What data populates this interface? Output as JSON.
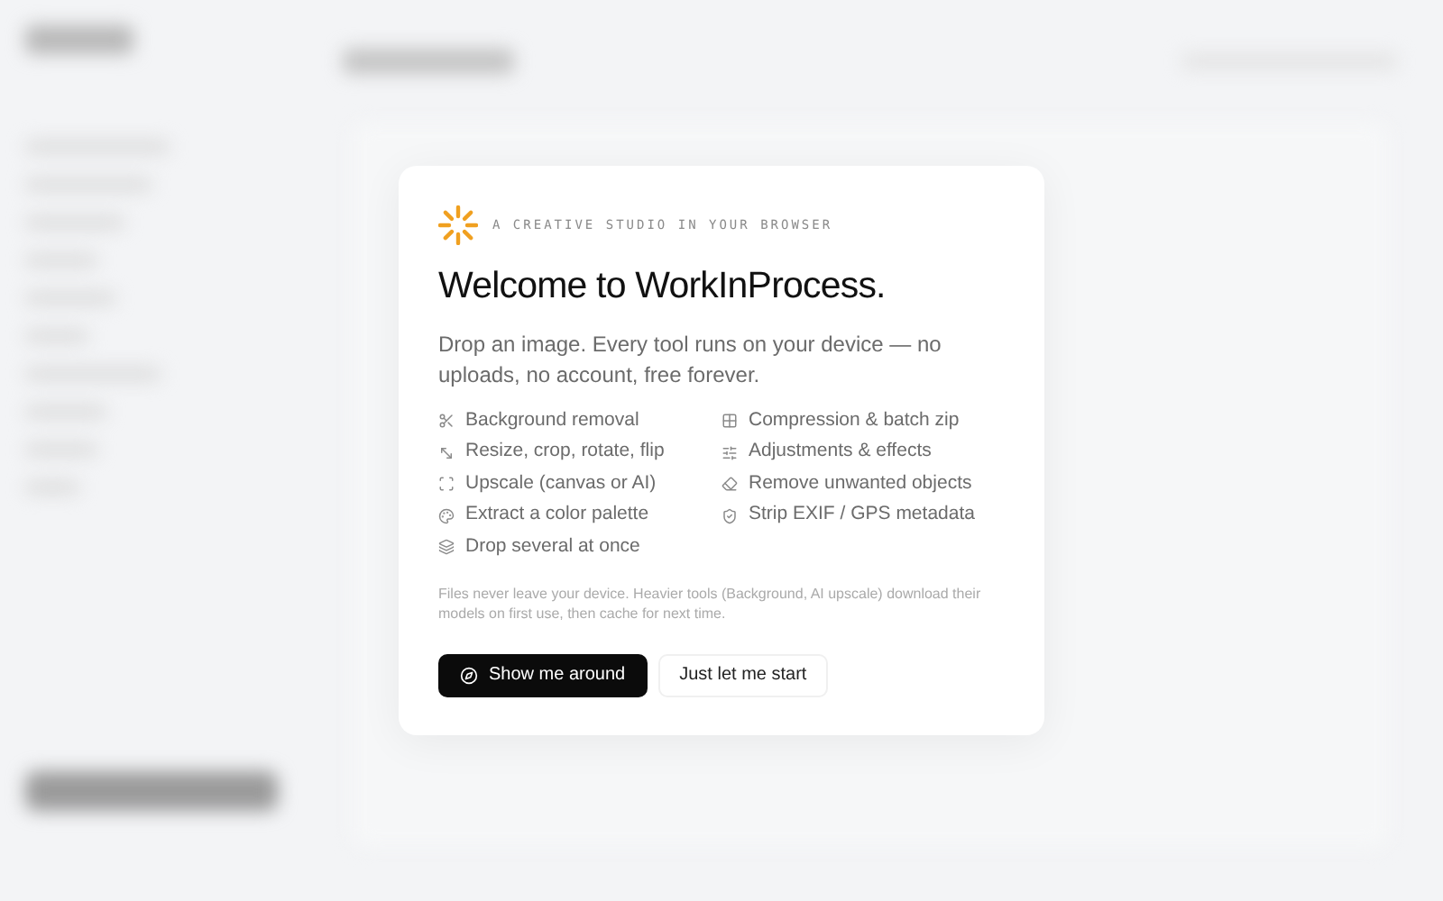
{
  "dialog": {
    "eyebrow": "A CREATIVE STUDIO IN YOUR BROWSER",
    "title": "Welcome to WorkInProcess.",
    "intro": "Drop an image. Every tool runs on your device — no uploads, no account, free forever.",
    "features_left": [
      "Background removal",
      "Resize, crop, rotate, flip",
      "Upscale (canvas or AI)",
      "Extract a color palette",
      "Drop several at once"
    ],
    "features_right": [
      "Compression & batch zip",
      "Adjustments & effects",
      "Remove unwanted objects",
      "Strip EXIF / GPS metadata"
    ],
    "note": "Files never leave your device. Heavier tools (Background, AI upscale) download their models on first use, then cache for next time.",
    "primary_button": "Show me around",
    "secondary_button": "Just let me start"
  }
}
